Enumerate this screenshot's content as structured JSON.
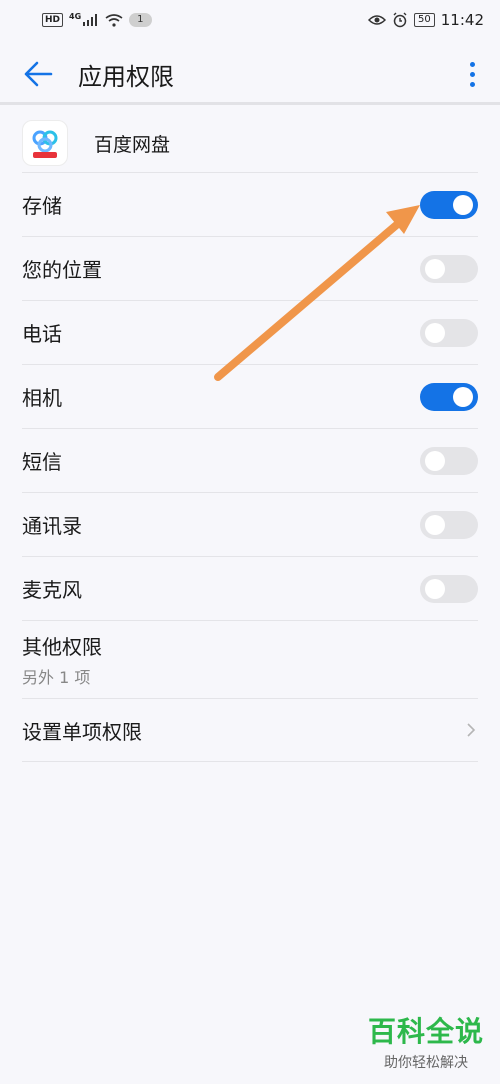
{
  "status_bar": {
    "hd": "HD",
    "network": "4G",
    "notification_count": "1",
    "battery": "50",
    "time": "11:42"
  },
  "app_bar": {
    "title": "应用权限"
  },
  "app": {
    "name": "百度网盘"
  },
  "permissions": [
    {
      "label": "存储",
      "enabled": true
    },
    {
      "label": "您的位置",
      "enabled": false
    },
    {
      "label": "电话",
      "enabled": false
    },
    {
      "label": "相机",
      "enabled": true
    },
    {
      "label": "短信",
      "enabled": false
    },
    {
      "label": "通讯录",
      "enabled": false
    },
    {
      "label": "麦克风",
      "enabled": false
    }
  ],
  "other": {
    "label": "其他权限",
    "sub": "另外 1 项"
  },
  "single": {
    "label": "设置单项权限"
  },
  "watermark": {
    "main": "百科全说",
    "sub": "助你轻松解决"
  },
  "colors": {
    "accent": "#1473e6",
    "toggle_off": "#e4e4e7",
    "annotation": "#f0964a",
    "watermark": "#2db84b"
  },
  "icons": {
    "back": "arrow-left-icon",
    "more": "more-vertical-icon",
    "chevron": "chevron-right-icon"
  }
}
